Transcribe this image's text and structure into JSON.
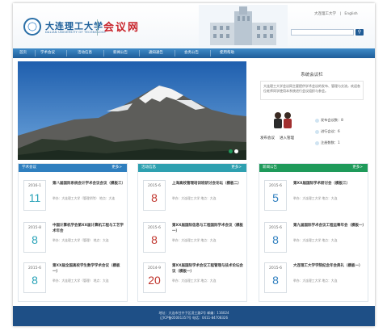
{
  "header": {
    "logo_cn": "大连理工大学",
    "logo_en": "DALIAN UNIVERSITY OF TECHNOLOGY",
    "site_name": "会议网",
    "links": [
      "大连理工大学",
      "English"
    ],
    "search_placeholder": "",
    "search_icon": "magnifier-icon"
  },
  "nav": [
    "首页",
    "学术会议",
    "活动信息",
    "新闻公告",
    "通知通告",
    "会务公告",
    "使用帮助"
  ],
  "banner": {
    "active_slide": 1,
    "slide_count": 2,
    "colors": {
      "active": "#1e9a5a",
      "inactive": "#ffffff"
    }
  },
  "intro": {
    "title": "系统会议栏",
    "text": "大连理工大学会议网主要提供学术会议的发布、管理与交流，欢迎各位老师同学使用本系统进行会议组织与参会。",
    "buttons": [
      "发布会议",
      "进入管理"
    ],
    "stats": [
      "发布会议数：8",
      "进行会议：6",
      "注册数数：1"
    ]
  },
  "columns": [
    {
      "title": "学术会议",
      "more": "更多>",
      "color": "#2f7fbf",
      "day_color": "#2aa3b8",
      "items": [
        {
          "ym": "2016-1",
          "day": "11",
          "title": "第八届国际系统会计学术会议会议（模板三）",
          "meta": "举办：大连理工大学（管理学院）  地点：大连"
        },
        {
          "ym": "2015-8",
          "day": "8",
          "title": "中国计算机学会第XX届计算机工程与工艺学术年会",
          "meta": "举办：大连理工大学（管理）  地点：大连"
        },
        {
          "ym": "2015-6",
          "day": "8",
          "title": "第XX届全国高校学生数学学术会议（模板一）",
          "meta": "举办：大连理工大学（管理）  地点：大连"
        }
      ]
    },
    {
      "title": "活动信息",
      "more": "更多>",
      "color": "#2ea0b0",
      "day_color": "#c0342c",
      "items": [
        {
          "ym": "2015-6",
          "day": "8",
          "title": "上海高校管理培训班研讨会论坛（模板二）",
          "meta": "举办：大连理工大学  地点：大连"
        },
        {
          "ym": "2015-6",
          "day": "8",
          "title": "第XX届国际信息与工程国际学术会议（模板一）",
          "meta": "举办：大连理工大学  地点：大连"
        },
        {
          "ym": "2014-9",
          "day": "20",
          "title": "第XX届国际学术会议工程管理与技术论坛会议（模板一）",
          "meta": "举办：大连理工大学  地点：大连"
        }
      ]
    },
    {
      "title": "新闻公告",
      "more": "更多>",
      "color": "#1e9a5a",
      "day_color": "#2f7fbf",
      "items": [
        {
          "ym": "2015-6",
          "day": "5",
          "title": "第XX届国际学术研讨会（模板三）",
          "meta": "举办：大连理工大学  地点：大连"
        },
        {
          "ym": "2015-6",
          "day": "8",
          "title": "第九届国际学术会议工程运筹年会（模板一）",
          "meta": "举办：大连理工大学  地点：大连"
        },
        {
          "ym": "2015-6",
          "day": "8",
          "title": "大连理工大学学院纪念年会典礼（模板一）",
          "meta": "举办：大连理工大学  地点：大连"
        }
      ]
    }
  ],
  "footer": {
    "line1": "地址：大连市甘井子区凌工路2号  邮编：116024",
    "line2": "辽ICP备05001357号  电话：0411-84708326"
  }
}
